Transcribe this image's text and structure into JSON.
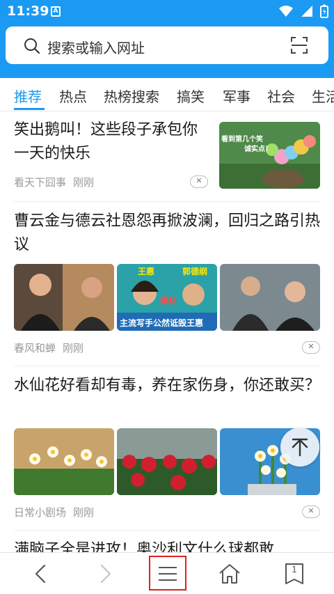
{
  "status_bar": {
    "time": "11:39",
    "notification_glyph": "A"
  },
  "search": {
    "placeholder": "搜索或输入网址"
  },
  "tabs": [
    {
      "label": "推荐",
      "active": true
    },
    {
      "label": "热点"
    },
    {
      "label": "热榜搜索"
    },
    {
      "label": "搞笑"
    },
    {
      "label": "军事"
    },
    {
      "label": "社会"
    },
    {
      "label": "生活"
    }
  ],
  "feed": [
    {
      "title": "笑出鹅叫！这些段子承包你一天的快乐",
      "source": "看天下囧事",
      "time": "刚刚",
      "thumb_text": [
        "看到第几个笑",
        "诚实点！"
      ]
    },
    {
      "title": "曹云金与德云社恩怨再掀波澜，回归之路引热议",
      "source": "春风和蝉",
      "time": "刚刚",
      "thumb_texts": [
        "王惠",
        "郭德纲",
        "爆料",
        "主流写手公然诋毁王惠"
      ]
    },
    {
      "title": "水仙花好看却有毒，养在家伤身，你还敢买？",
      "source": "日常小剧场",
      "time": "刚刚"
    },
    {
      "title": "满脑子全是进攻！奥沙利文什么球都敢"
    }
  ],
  "bottom_bar": {
    "tab_count": "1"
  },
  "colors": {
    "accent": "#1a9af3",
    "highlight": "#e02020"
  }
}
